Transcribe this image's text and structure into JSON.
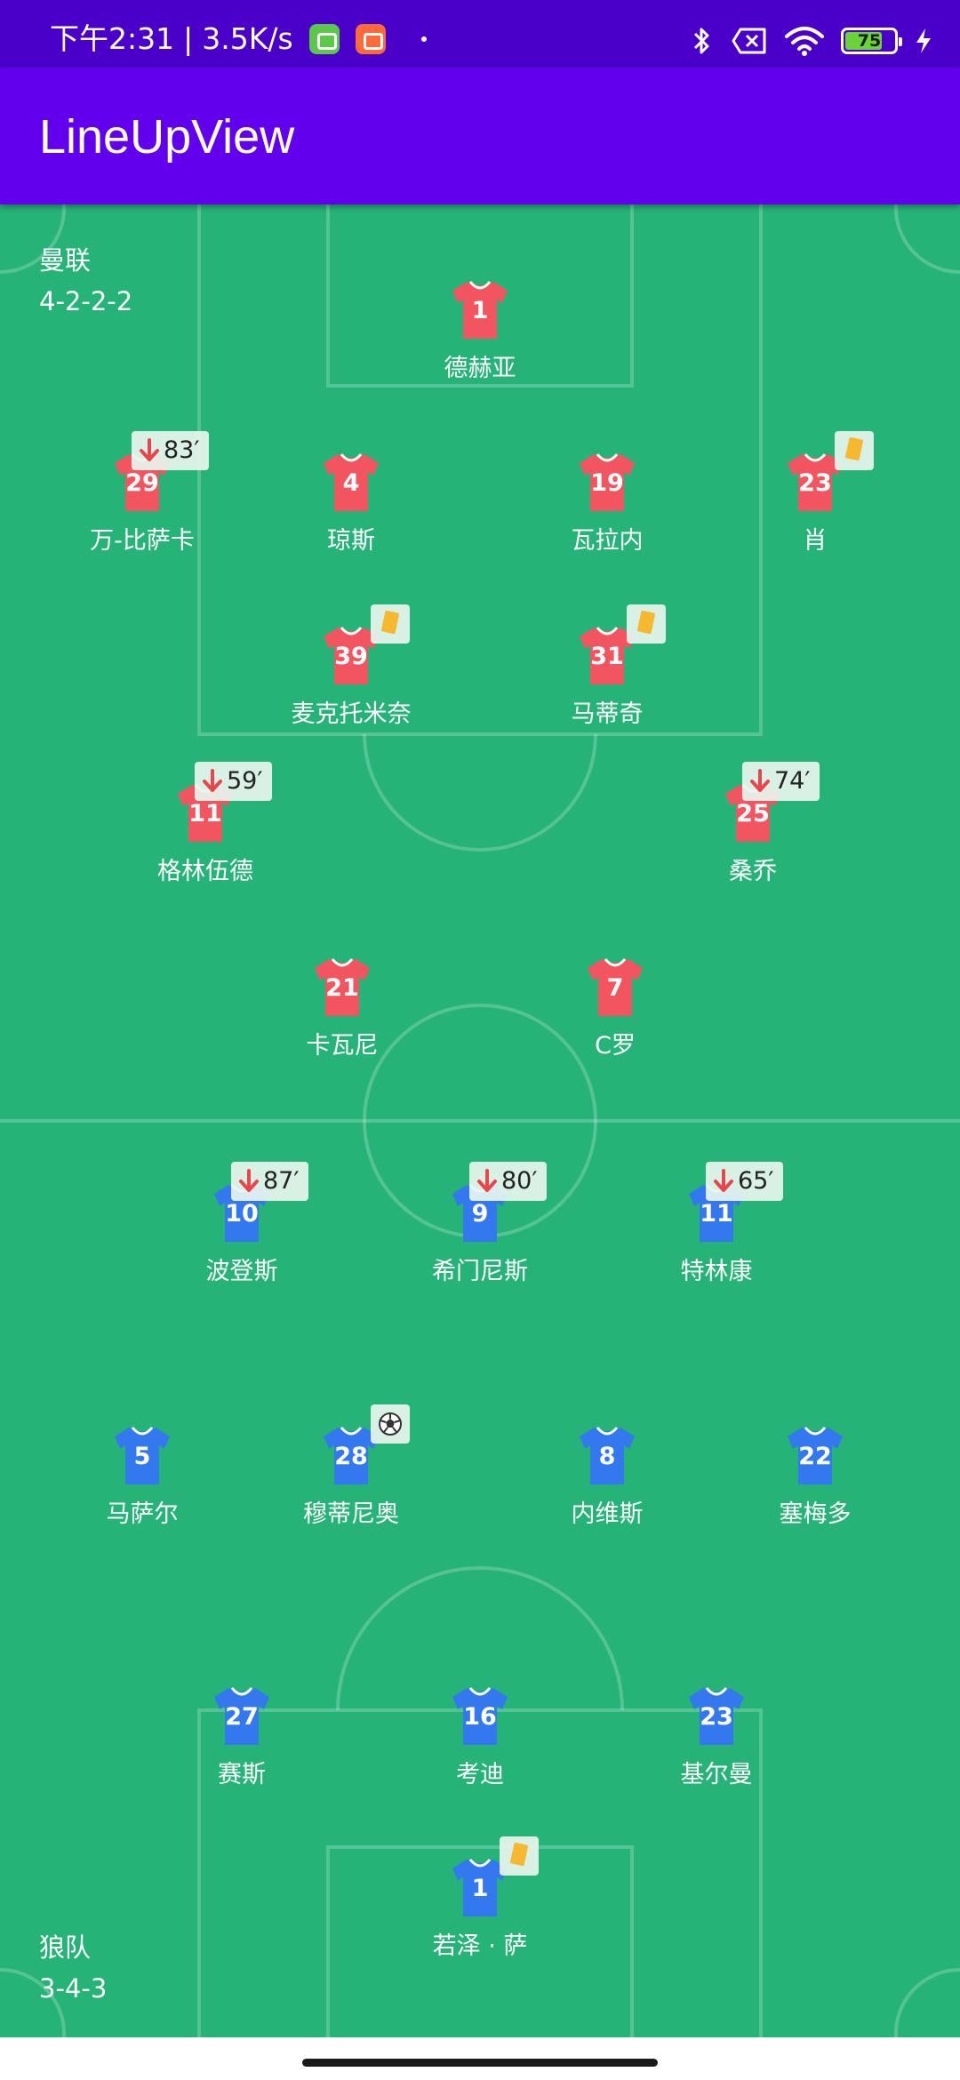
{
  "status_bar": {
    "time": "下午2:31",
    "separator": "|",
    "net_speed": "3.5K/s",
    "notification_icons": [
      "green-app-icon",
      "orange-app-icon"
    ],
    "battery_level": 75,
    "battery_text": "75",
    "indicators": [
      "bluetooth-icon",
      "no-sim-icon",
      "wifi-icon",
      "battery-icon",
      "charging-bolt-icon"
    ]
  },
  "app_bar": {
    "title": "LineUpView"
  },
  "colors": {
    "status_bar": "#4a00c8",
    "app_bar": "#6200ee",
    "pitch": "#26b378",
    "home_shirt": "#f25560",
    "away_shirt": "#3478f0",
    "yellow_card": "#f5b82e",
    "sub_arrow": "#e8464a"
  },
  "home_team": {
    "name": "曼联",
    "formation": "4-2-2-2",
    "players": [
      {
        "number": "1",
        "name": "德赫亚",
        "event": null
      },
      {
        "number": "29",
        "name": "万-比萨卡",
        "event": "sub",
        "minute": "83′"
      },
      {
        "number": "4",
        "name": "琼斯",
        "event": null
      },
      {
        "number": "19",
        "name": "瓦拉内",
        "event": null
      },
      {
        "number": "23",
        "name": "肖",
        "event": "yellow-card"
      },
      {
        "number": "39",
        "name": "麦克托米奈",
        "event": "yellow-card"
      },
      {
        "number": "31",
        "name": "马蒂奇",
        "event": "yellow-card"
      },
      {
        "number": "11",
        "name": "格林伍德",
        "event": "sub",
        "minute": "59′"
      },
      {
        "number": "25",
        "name": "桑乔",
        "event": "sub",
        "minute": "74′"
      },
      {
        "number": "21",
        "name": "卡瓦尼",
        "event": null
      },
      {
        "number": "7",
        "name": "C罗",
        "event": null
      }
    ]
  },
  "away_team": {
    "name": "狼队",
    "formation": "3-4-3",
    "players": [
      {
        "number": "10",
        "name": "波登斯",
        "event": "sub",
        "minute": "87′"
      },
      {
        "number": "9",
        "name": "希门尼斯",
        "event": "sub",
        "minute": "80′"
      },
      {
        "number": "11",
        "name": "特林康",
        "event": "sub",
        "minute": "65′"
      },
      {
        "number": "5",
        "name": "马萨尔",
        "event": null
      },
      {
        "number": "28",
        "name": "穆蒂尼奥",
        "event": "goal"
      },
      {
        "number": "8",
        "name": "内维斯",
        "event": null
      },
      {
        "number": "22",
        "name": "塞梅多",
        "event": null
      },
      {
        "number": "27",
        "name": "赛斯",
        "event": null
      },
      {
        "number": "16",
        "name": "考迪",
        "event": null
      },
      {
        "number": "23",
        "name": "基尔曼",
        "event": null
      },
      {
        "number": "1",
        "name": "若泽 · 萨",
        "event": "yellow-card"
      }
    ]
  }
}
